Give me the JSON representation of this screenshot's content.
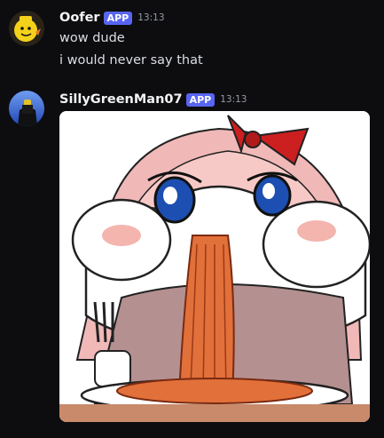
{
  "messages": [
    {
      "username": "Oofer",
      "badge": "APP",
      "timestamp": "13:13",
      "avatar": "yellow-cartoon-head",
      "lines": [
        "wow dude",
        "i would never say that"
      ]
    },
    {
      "username": "SillyGreenMan07",
      "badge": "APP",
      "timestamp": "13:13",
      "avatar": "dark-figure-blue-background",
      "attachment": "anime-girl-eating-spaghetti-image"
    }
  ],
  "colors": {
    "background": "#0d0d10",
    "badge": "#5865f2",
    "username": "#f2f3f5",
    "message_text": "#dbdee1",
    "timestamp": "#949ba4"
  }
}
